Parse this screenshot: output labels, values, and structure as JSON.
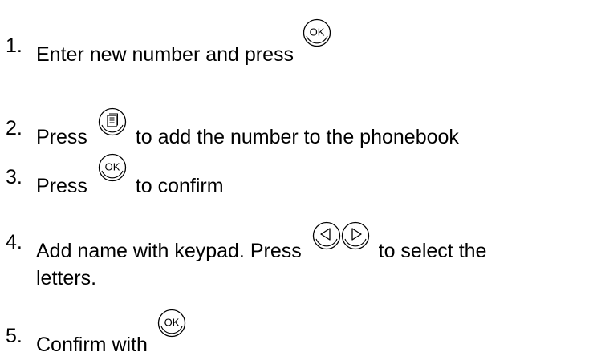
{
  "steps": [
    {
      "number": "1.",
      "text_before": "Enter new number and press",
      "icons": [
        "ok-key-icon"
      ],
      "text_after": ""
    },
    {
      "number": "2.",
      "text_before": "Press",
      "icons": [
        "phonebook-key-icon"
      ],
      "text_after": "to add the number to the phonebook"
    },
    {
      "number": "3.",
      "text_before": "Press",
      "icons": [
        "ok-key-icon"
      ],
      "text_after": "to confirm"
    },
    {
      "number": "4.",
      "text_before": "Add name with keypad. Press",
      "icons": [
        "left-arrow-key-icon",
        "right-arrow-key-icon"
      ],
      "text_after": "to select the",
      "text_line2": "letters."
    },
    {
      "number": "5.",
      "text_before": "Confirm with",
      "icons": [
        "ok-key-icon"
      ],
      "text_after": ""
    }
  ],
  "keys": {
    "ok_label": "OK"
  }
}
